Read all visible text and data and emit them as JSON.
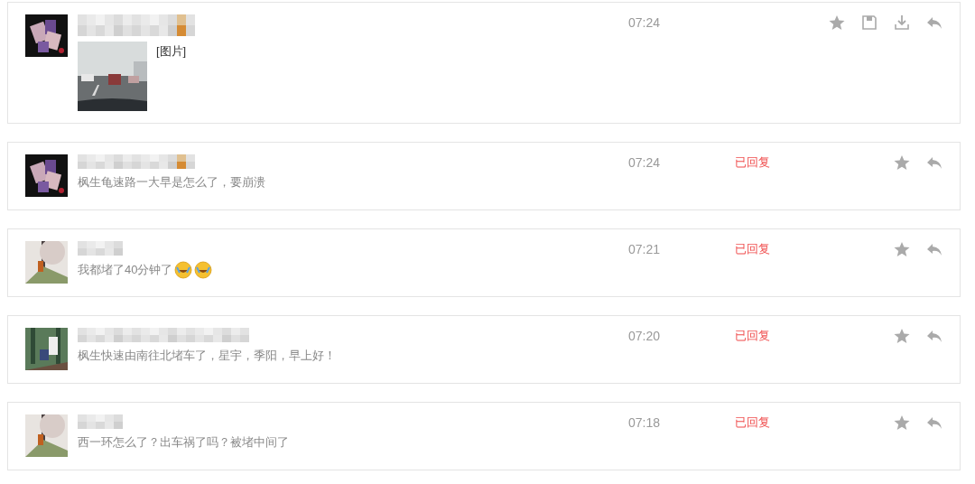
{
  "messages": [
    {
      "text": "[图片]",
      "time": "07:24",
      "actions": [
        {
          "kind": "star"
        },
        {
          "kind": "save"
        },
        {
          "kind": "download"
        },
        {
          "kind": "reply"
        }
      ]
    },
    {
      "kind": "text",
      "text": "枫生龟速路一大早是怎么了，要崩溃",
      "time": "07:24",
      "reply_status": "已回复",
      "actions": [
        {
          "kind": "star"
        },
        {
          "kind": "reply"
        }
      ]
    },
    {
      "kind": "text",
      "text": "我都堵了40分钟了",
      "emojis": [
        {
          "kind": "laughing-tears"
        },
        {
          "kind": "laughing-tears"
        }
      ],
      "time": "07:21",
      "reply_status": "已回复",
      "actions": [
        {
          "kind": "star"
        },
        {
          "kind": "reply"
        }
      ]
    },
    {
      "kind": "text",
      "text": "枫生快速由南往北堵车了，星宇，季阳，早上好！",
      "time": "07:20",
      "reply_status": "已回复",
      "actions": [
        {
          "kind": "star"
        },
        {
          "kind": "reply"
        }
      ]
    },
    {
      "kind": "text",
      "text": "西一环怎么了？出车祸了吗？被堵中间了",
      "time": "07:18",
      "reply_status": "已回复",
      "actions": [
        {
          "kind": "star"
        },
        {
          "kind": "reply"
        }
      ]
    }
  ]
}
